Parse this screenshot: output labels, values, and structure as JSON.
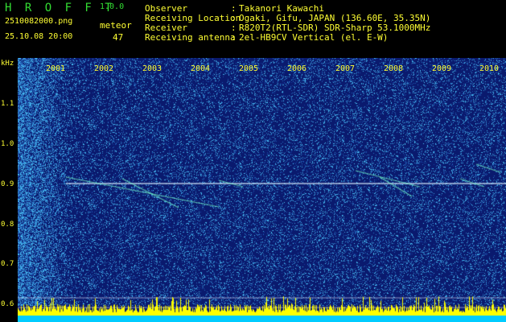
{
  "header": {
    "app_title": "H R O F F T",
    "app_version": "1.0.0",
    "file_name": "2510082000.png",
    "timestamp": "25.10.08 20:00",
    "meteor_label": "meteor",
    "meteor_count": "47",
    "info": [
      {
        "key": "Observer",
        "value": "Takanori Kawachi"
      },
      {
        "key": "Receiving Location",
        "value": "Ogaki, Gifu, JAPAN (136.60E, 35.35N)"
      },
      {
        "key": "Receiver",
        "value": "R820T2(RTL-SDR) SDR-Sharp 53.1000MHz"
      },
      {
        "key": "Receiving antenna",
        "value": "2el-HB9CV Vertical (el. E-W)"
      }
    ],
    "separator": ":"
  },
  "spectrogram": {
    "y_unit": "kHz",
    "y_ticks": [
      "1.1",
      "1.0",
      "0.9",
      "0.8",
      "0.7",
      "0.6"
    ],
    "x_ticks": [
      "2001",
      "2002",
      "2003",
      "2004",
      "2005",
      "2006",
      "2007",
      "2008",
      "2009",
      "2010"
    ],
    "colors": {
      "background": "#0a1a6e",
      "noise_high": "#55ccff",
      "carrier": "#ffffff",
      "power_bar": "#ffff00",
      "floor": "#00ccff",
      "text": "#ffff33"
    }
  }
}
